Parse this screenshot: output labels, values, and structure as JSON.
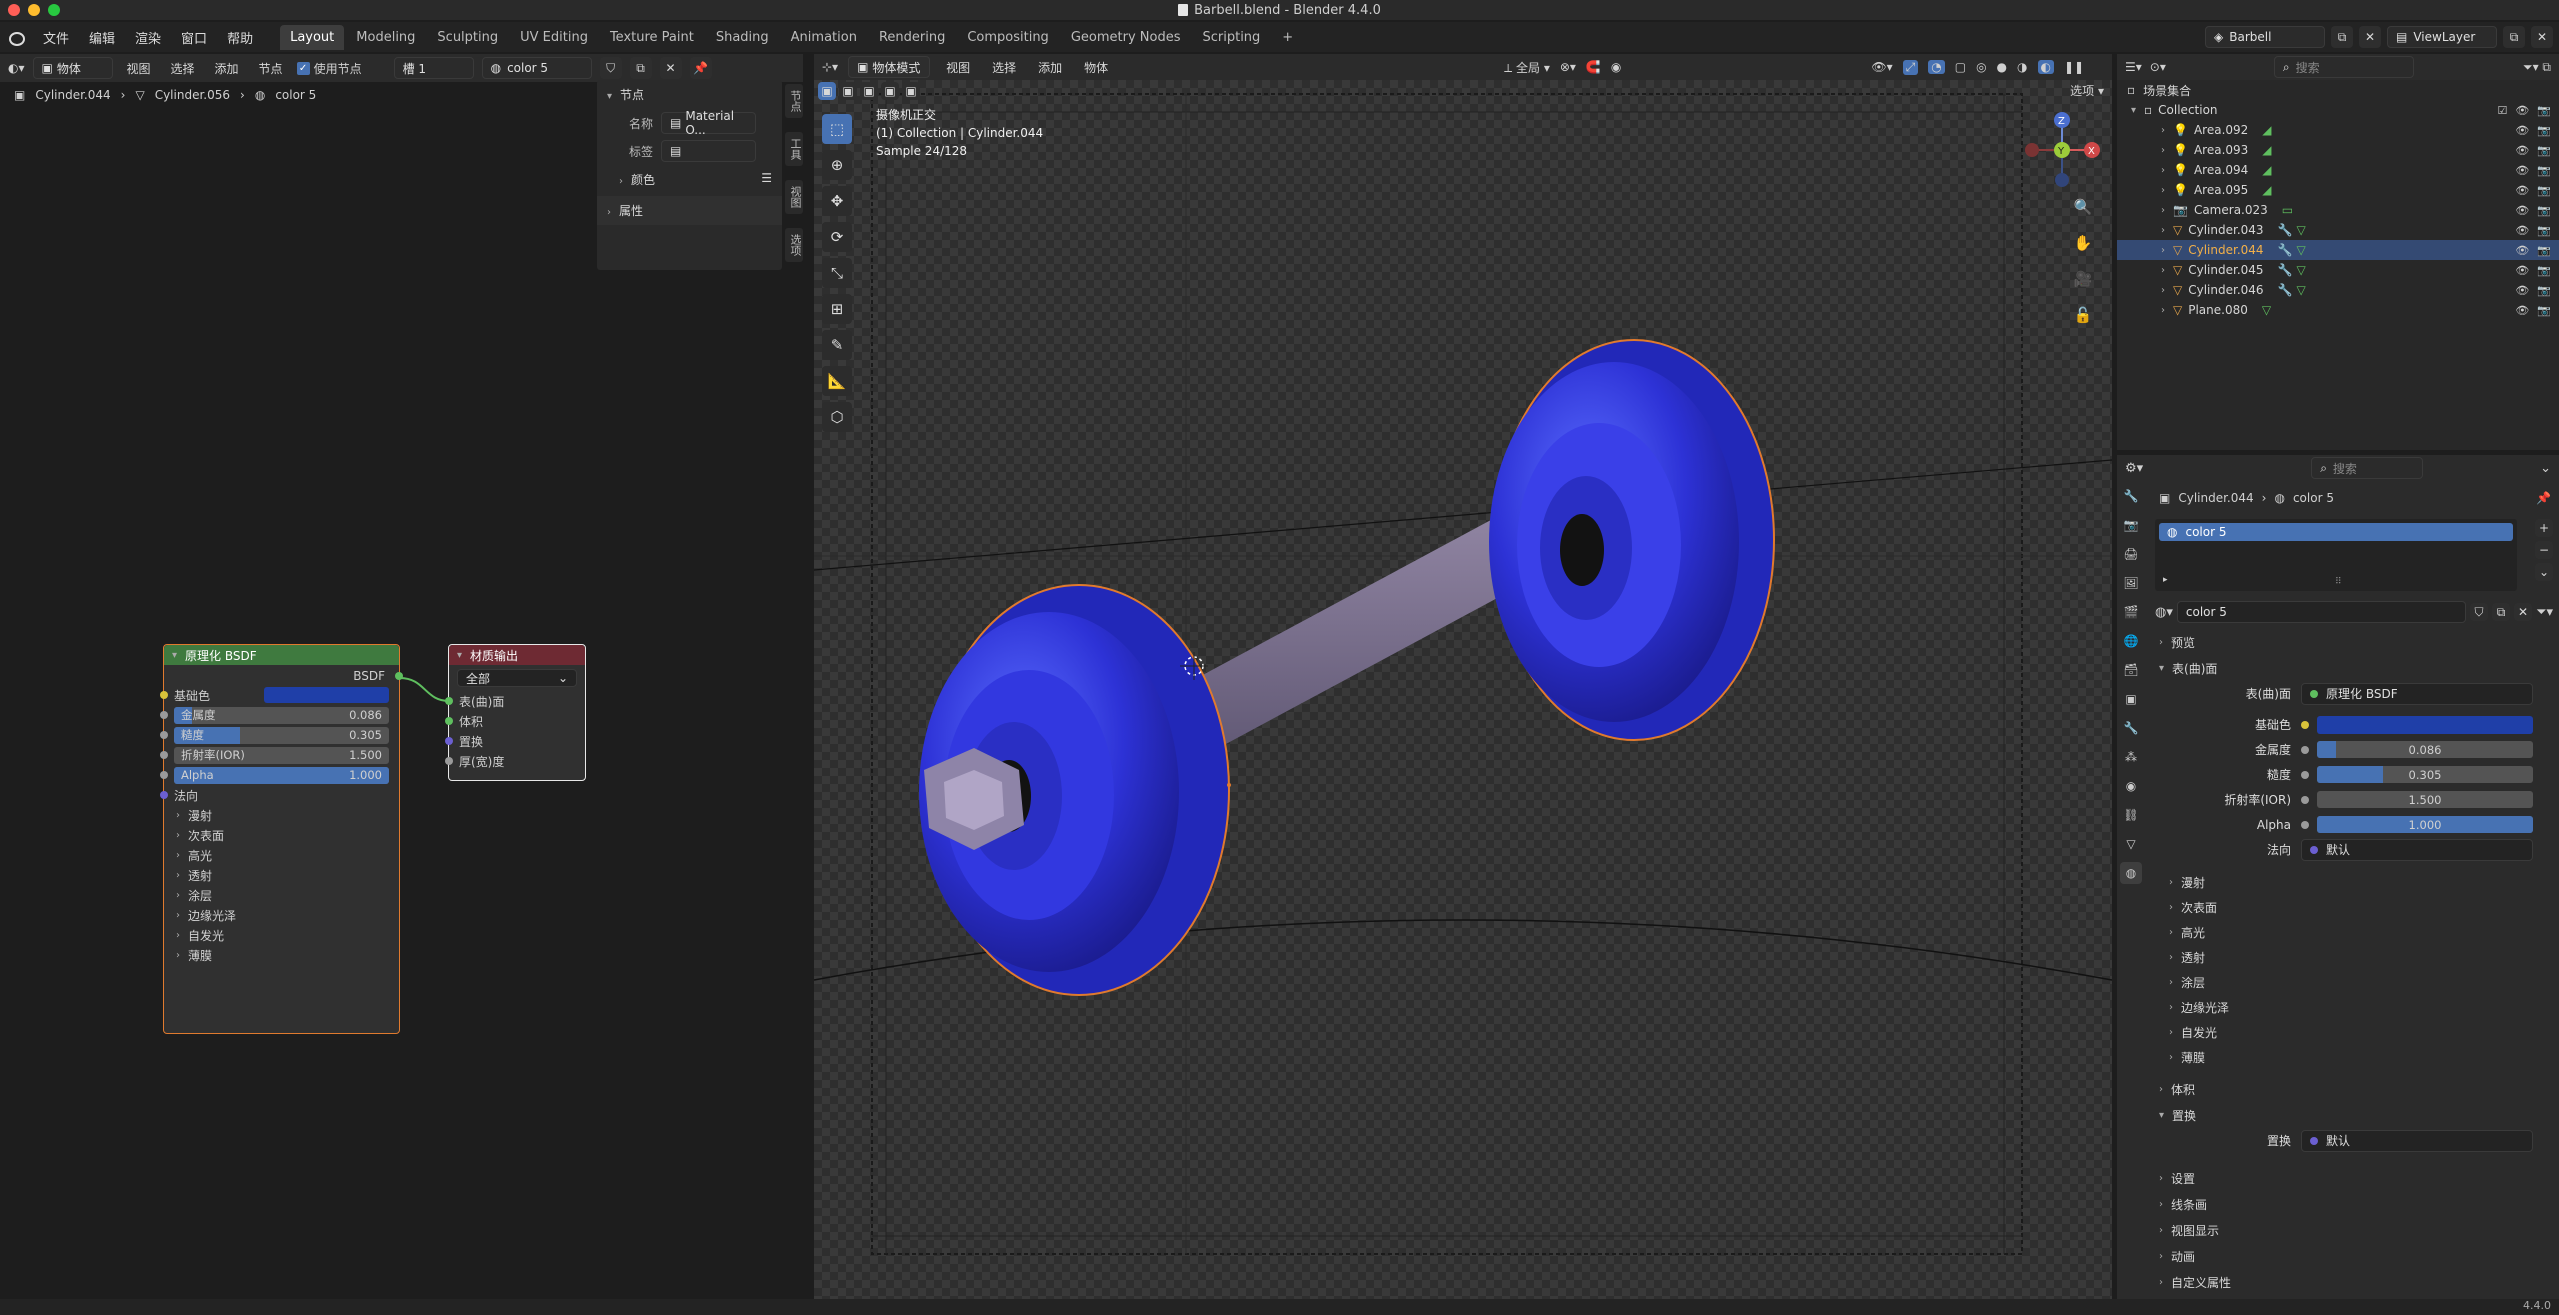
{
  "window": {
    "title": "Barbell.blend - Blender 4.4.0"
  },
  "menu": [
    "文件",
    "编辑",
    "渲染",
    "窗口",
    "帮助"
  ],
  "workspaces": [
    "Layout",
    "Modeling",
    "Sculpting",
    "UV Editing",
    "Texture Paint",
    "Shading",
    "Animation",
    "Rendering",
    "Compositing",
    "Geometry Nodes",
    "Scripting"
  ],
  "active_workspace": "Layout",
  "scene": {
    "name": "Barbell",
    "view_layer": "ViewLayer"
  },
  "node_editor": {
    "header": {
      "type": "物体",
      "menus": [
        "视图",
        "选择",
        "添加",
        "节点"
      ],
      "use_nodes_label": "使用节点",
      "slot": "槽 1",
      "material": "color 5"
    },
    "breadcrumb": [
      "Cylinder.044",
      "Cylinder.056",
      "color 5"
    ],
    "n_panel": {
      "section_node": "节点",
      "name_label": "名称",
      "name_value": "Material O...",
      "label_label": "标签",
      "color_label": "颜色",
      "properties_label": "属性",
      "tabs": [
        "节点",
        "工具",
        "视图",
        "选项"
      ]
    },
    "bsdf_node": {
      "title": "原理化 BSDF",
      "output": "BSDF",
      "base_color_label": "基础色",
      "metallic_label": "金属度",
      "metallic": "0.086",
      "metallic_fill": 0.086,
      "roughness_label": "糙度",
      "roughness": "0.305",
      "roughness_fill": 0.305,
      "ior_label": "折射率(IOR)",
      "ior": "1.500",
      "alpha_label": "Alpha",
      "alpha": "1.000",
      "alpha_fill": 1.0,
      "normal_label": "法向",
      "subsections": [
        "漫射",
        "次表面",
        "高光",
        "透射",
        "涂层",
        "边缘光泽",
        "自发光",
        "薄膜"
      ]
    },
    "output_node": {
      "title": "材质输出",
      "target": "全部",
      "inputs": [
        "表(曲)面",
        "体积",
        "置换",
        "厚(宽)度"
      ]
    }
  },
  "viewport": {
    "header": {
      "mode": "物体模式",
      "menus": [
        "视图",
        "选择",
        "添加",
        "物体"
      ],
      "transform": "全局",
      "options": "选项"
    },
    "overlay": {
      "view_name": "摄像机正交",
      "collection": "(1) Collection | Cylinder.044",
      "sample": "Sample 24/128"
    }
  },
  "outliner": {
    "search_placeholder": "搜索",
    "root": "场景集合",
    "collection": "Collection",
    "items": [
      "Area.092",
      "Area.093",
      "Area.094",
      "Area.095",
      "Camera.023",
      "Cylinder.043",
      "Cylinder.044",
      "Cylinder.045",
      "Cylinder.046",
      "Plane.080"
    ],
    "selected": "Cylinder.044"
  },
  "properties": {
    "search_placeholder": "搜索",
    "path": [
      "Cylinder.044",
      "color 5"
    ],
    "slot": "color 5",
    "material": "color 5",
    "sections": {
      "preview": "预览",
      "surface": "表(曲)面",
      "surface_label": "表(曲)面",
      "surface_value": "原理化 BSDF",
      "base_color": "基础色",
      "metallic": "金属度",
      "metallic_value": "0.086",
      "roughness": "糙度",
      "roughness_value": "0.305",
      "ior": "折射率(IOR)",
      "ior_value": "1.500",
      "alpha": "Alpha",
      "alpha_value": "1.000",
      "normal": "法向",
      "normal_value": "默认",
      "sub": [
        "漫射",
        "次表面",
        "高光",
        "透射",
        "涂层",
        "边缘光泽",
        "自发光",
        "薄膜"
      ],
      "volume": "体积",
      "displacement": "置换",
      "displacement_label": "置换",
      "displacement_value": "默认",
      "settings": "设置",
      "lineart": "线条画",
      "viewport_display": "视图显示",
      "animation": "动画",
      "custom": "自定义属性"
    }
  },
  "status": {
    "version": "4.4.0"
  },
  "colors": {
    "accent": "#4772b3",
    "base_color": "#1f3fa8",
    "selection": "#344a73",
    "node_bsdf_header": "#3f7a3f",
    "node_output_header": "#6e2a33"
  }
}
